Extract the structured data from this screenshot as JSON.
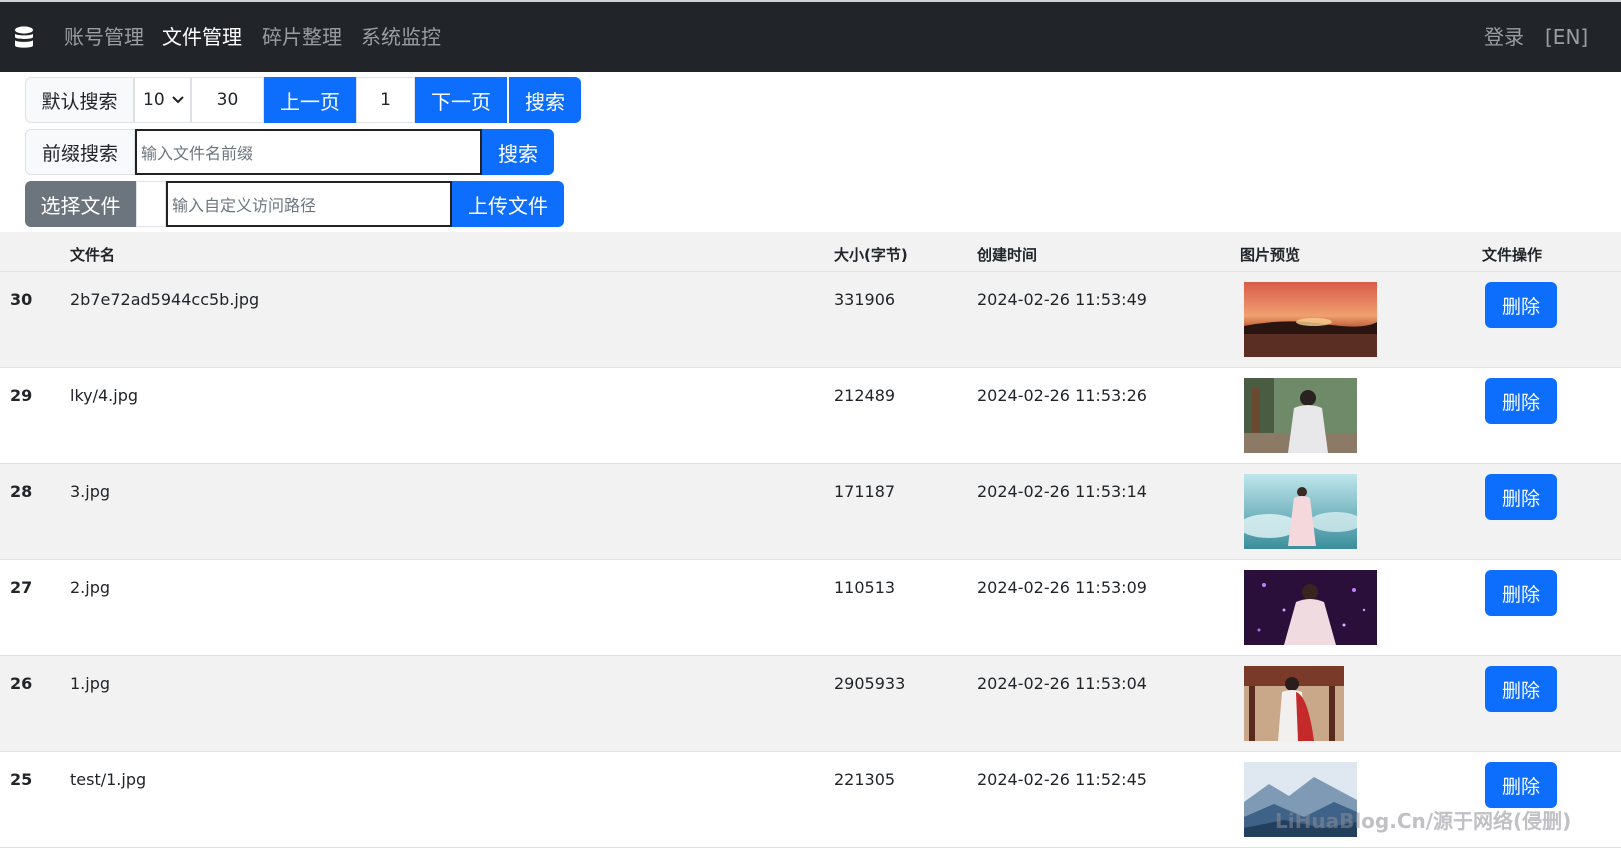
{
  "nav": {
    "items": [
      {
        "label": "账号管理"
      },
      {
        "label": "文件管理"
      },
      {
        "label": "碎片整理"
      },
      {
        "label": "系统监控"
      }
    ],
    "login": "登录",
    "lang": "[EN]"
  },
  "toolbar": {
    "default_search_label": "默认搜索",
    "page_size": "10",
    "count_value": "30",
    "prev_label": "上一页",
    "page_value": "1",
    "next_label": "下一页",
    "search_label": "搜索",
    "prefix_search_label": "前缀搜索",
    "prefix_placeholder": "输入文件名前缀",
    "prefix_search_button": "搜索",
    "choose_file_label": "选择文件",
    "path_placeholder": "输入自定义访问路径",
    "upload_label": "上传文件"
  },
  "table": {
    "headers": {
      "filename": "文件名",
      "size": "大小(字节)",
      "created": "创建时间",
      "preview": "图片预览",
      "actions": "文件操作"
    },
    "delete_label": "删除",
    "rows": [
      {
        "id": "30",
        "filename": "2b7e72ad5944cc5b.jpg",
        "size": "331906",
        "created": "2024-02-26 11:53:49",
        "preview": "sunset-beach-image"
      },
      {
        "id": "29",
        "filename": "lky/4.jpg",
        "size": "212489",
        "created": "2024-02-26 11:53:26",
        "preview": "woman-willow-image"
      },
      {
        "id": "28",
        "filename": "3.jpg",
        "size": "171187",
        "created": "2024-02-26 11:53:14",
        "preview": "woman-clouds-image"
      },
      {
        "id": "27",
        "filename": "2.jpg",
        "size": "110513",
        "created": "2024-02-26 11:53:09",
        "preview": "woman-stage-image"
      },
      {
        "id": "26",
        "filename": "1.jpg",
        "size": "2905933",
        "created": "2024-02-26 11:53:04",
        "preview": "woman-red-cape-image"
      },
      {
        "id": "25",
        "filename": "test/1.jpg",
        "size": "221305",
        "created": "2024-02-26 11:52:45",
        "preview": "mountain-mist-image"
      }
    ]
  },
  "watermark": "LiHuaBlog.Cn/源于网络(侵删)",
  "colors": {
    "primary": "#0d6efd",
    "secondary": "#6c757d",
    "navbar": "#212529"
  }
}
